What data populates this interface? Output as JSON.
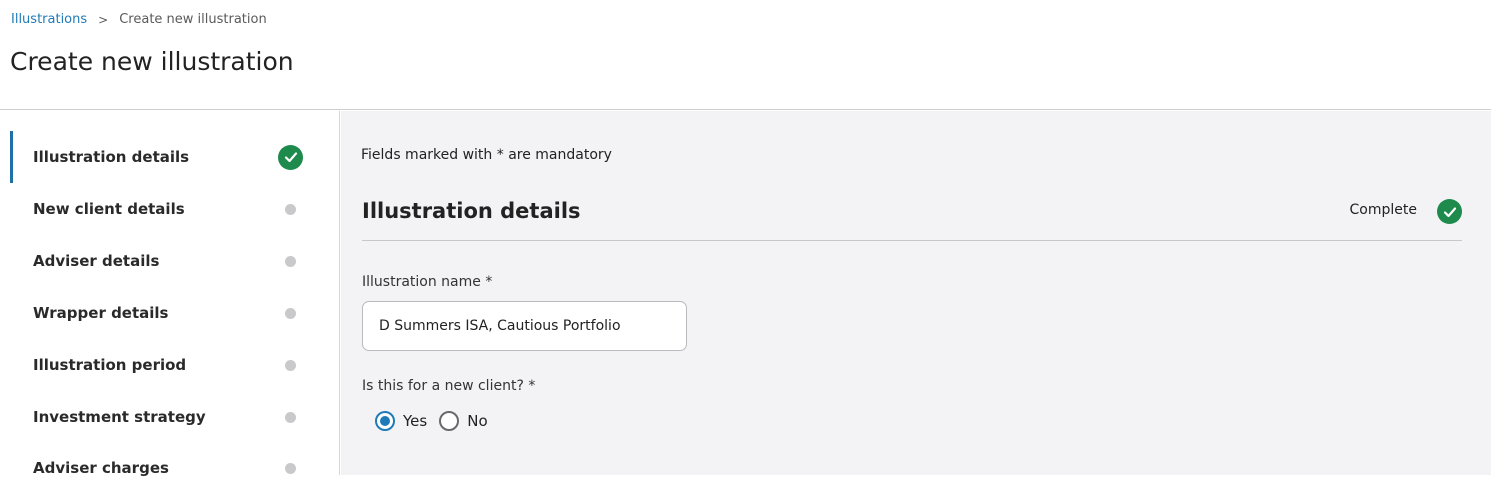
{
  "breadcrumb": {
    "root_label": "Illustrations",
    "separator": ">",
    "current_label": "Create new illustration"
  },
  "page_title": "Create new illustration",
  "sidebar": {
    "items": [
      {
        "label": "Illustration details",
        "status": "complete",
        "icon": "check-circle-icon",
        "active": true
      },
      {
        "label": "New client details",
        "status": "incomplete",
        "icon": "dot-icon",
        "active": false
      },
      {
        "label": "Adviser details",
        "status": "incomplete",
        "icon": "dot-icon",
        "active": false
      },
      {
        "label": "Wrapper details",
        "status": "incomplete",
        "icon": "dot-icon",
        "active": false
      },
      {
        "label": "Illustration period",
        "status": "incomplete",
        "icon": "dot-icon",
        "active": false
      },
      {
        "label": "Investment strategy",
        "status": "incomplete",
        "icon": "dot-icon",
        "active": false
      },
      {
        "label": "Adviser charges",
        "status": "incomplete",
        "icon": "dot-icon",
        "active": false
      }
    ]
  },
  "main": {
    "mandatory_note": "Fields marked with * are mandatory",
    "section": {
      "title": "Illustration details",
      "status_label": "Complete",
      "status_icon": "check-circle-icon"
    },
    "illustration_name": {
      "label": "Illustration name *",
      "value": "D Summers ISA, Cautious Portfolio"
    },
    "new_client": {
      "label": "Is this for a new client? *",
      "options": [
        {
          "label": "Yes",
          "checked": true
        },
        {
          "label": "No",
          "checked": false
        }
      ]
    }
  },
  "colors": {
    "accent": "#1f7bb8",
    "active_indicator": "#1f6fa8",
    "complete_green": "#1e8a4c",
    "incomplete_dot": "#c9c9cc",
    "main_background": "#f3f3f5"
  }
}
